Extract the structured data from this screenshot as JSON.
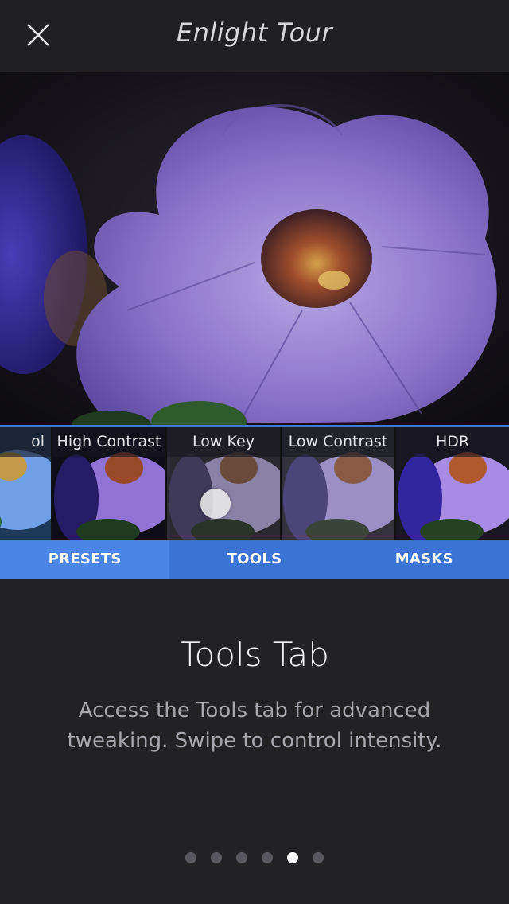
{
  "header": {
    "title": "Enlight Tour",
    "close_icon": "close-icon"
  },
  "presets": [
    {
      "label": "ol"
    },
    {
      "label": "High Contrast"
    },
    {
      "label": "Low Key"
    },
    {
      "label": "Low Contrast"
    },
    {
      "label": "HDR"
    }
  ],
  "tabs": [
    {
      "label": "PRESETS",
      "active": true
    },
    {
      "label": "TOOLS",
      "active": false
    },
    {
      "label": "MASKS",
      "active": false
    }
  ],
  "content": {
    "heading": "Tools Tab",
    "description": "Access the Tools tab for advanced tweaking. Swipe to control intensity."
  },
  "pagination": {
    "total": 6,
    "active_index": 4
  },
  "colors": {
    "accent": "#4b86e6",
    "tab_bg": "#3a73d3",
    "background": "#222224"
  }
}
